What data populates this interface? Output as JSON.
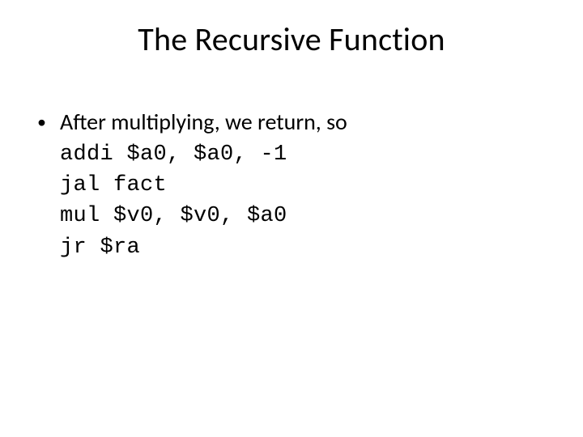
{
  "slide": {
    "title": "The Recursive Function",
    "bullet": {
      "dot": "•",
      "text": "After multiplying, we return, so"
    },
    "code": {
      "l1": "addi $a0, $a0, -1",
      "l2": "jal fact",
      "l3": "mul $v0, $v0, $a0",
      "l4": "jr $ra"
    }
  }
}
